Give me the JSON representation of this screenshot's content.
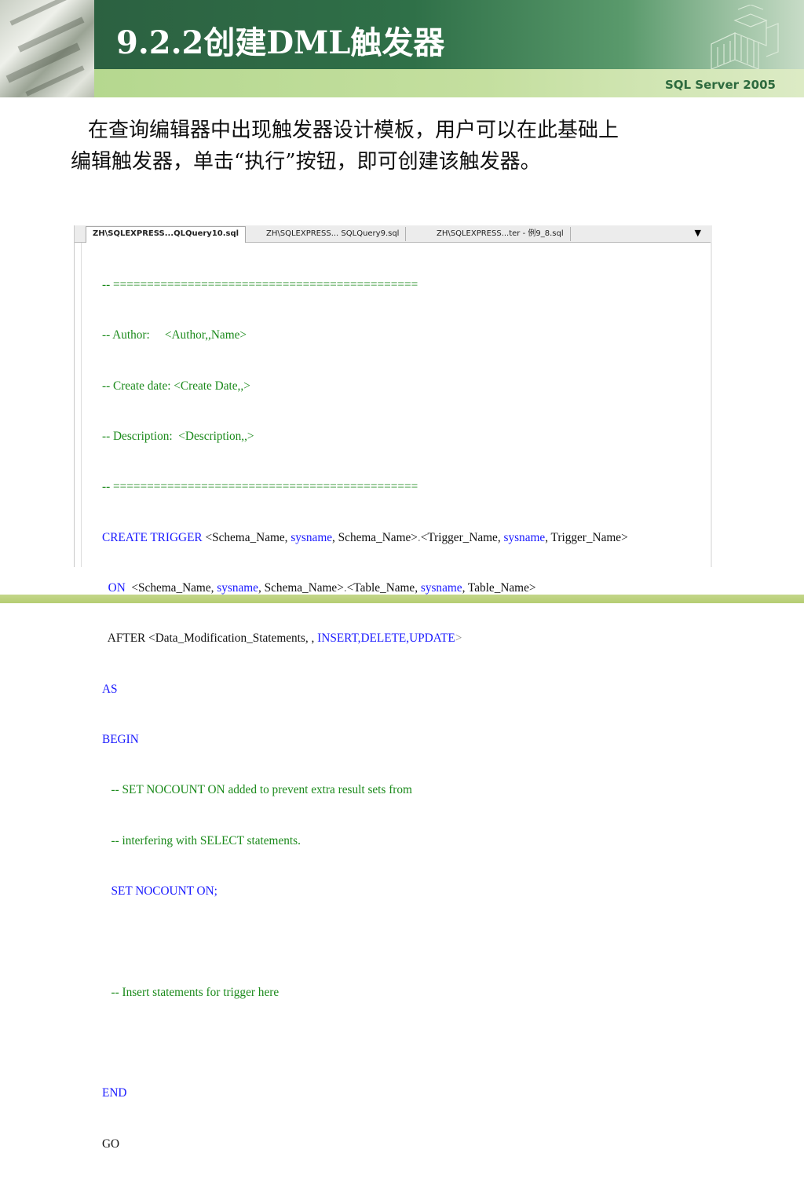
{
  "slide": {
    "title": "9.2.2创建DML触发器",
    "brand": "SQL Server 2005",
    "body_line1": "在查询编辑器中出现触发器设计模板，用户可以在此基础上",
    "body_line2": "编辑触发器，单击“执行”按钮，即可创建该触发器。"
  },
  "editor": {
    "tabs": [
      {
        "label": "ZH\\SQLEXPRESS...QLQuery10.sql",
        "active": true
      },
      {
        "label": "ZH\\SQLEXPRESS... SQLQuery9.sql",
        "active": false
      },
      {
        "label": "ZH\\SQLEXPRESS...ter - 例9_8.sql",
        "active": false
      }
    ],
    "dropdown_icon": "dropdown-arrow-icon",
    "code": {
      "sep1_prefix": "-- ",
      "sep1_bar": "=============================================",
      "author": "-- Author:     <Author,,Name>",
      "create_date": "-- Create date: <Create Date,,>",
      "description": "-- Description:  <Description,,>",
      "sep2_prefix": "-- ",
      "sep2_bar": "=============================================",
      "l6_kw": "CREATE TRIGGER",
      "l6_a": " <Schema_Name, ",
      "l6_b": "sysname",
      "l6_c": ", Schema_Name>",
      "l6_d": ".",
      "l6_e": "<Trigger_Name, ",
      "l6_f": "sysname",
      "l6_g": ", Trigger_Name>",
      "l7_kw": "  ON",
      "l7_a": "  <Schema_Name, ",
      "l7_b": "sysname",
      "l7_c": ", Schema_Name>",
      "l7_d": ".",
      "l7_e": "<Table_Name, ",
      "l7_f": "sysname",
      "l7_g": ", Table_Name>",
      "l8_a": "  AFTER <Data_Modification_Statements, , ",
      "l8_b": "INSERT,DELETE,UPDATE",
      "l8_c": ">",
      "as": "AS",
      "begin": "BEGIN",
      "comment1": "   -- SET NOCOUNT ON added to prevent extra result sets from",
      "comment2": "   -- interfering with SELECT statements.",
      "set_nocount": "   SET NOCOUNT ON;",
      "blank": "",
      "comment3": "   -- Insert statements for trigger here",
      "blank2": "",
      "end": "END",
      "go": "GO"
    }
  },
  "colors": {
    "header_green": "#2f7048",
    "stripe_green": "#c4df9f",
    "comment_green": "#1b8a1b",
    "keyword_blue": "#1a1aff"
  }
}
